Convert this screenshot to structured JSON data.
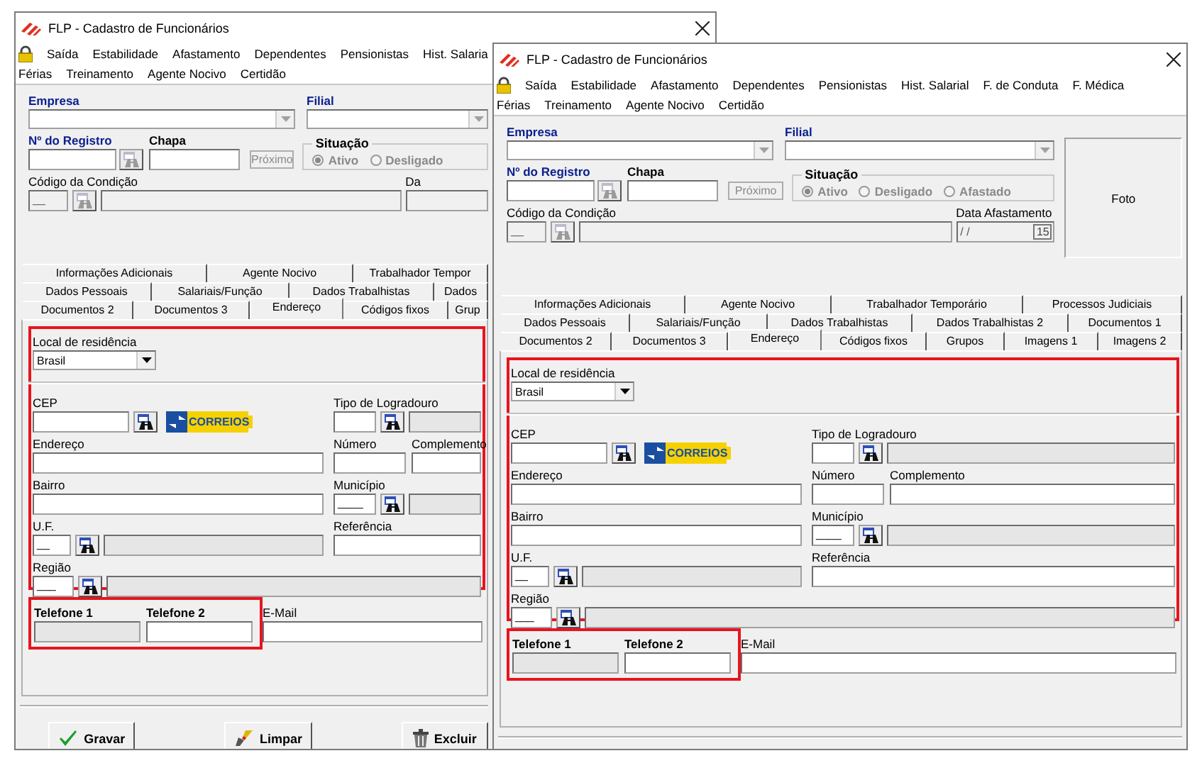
{
  "windows": [
    {
      "title": "FLP - Cadastro de Funcionários",
      "menu_rows": [
        [
          "Saída",
          "Estabilidade",
          "Afastamento",
          "Dependentes",
          "Pensionistas",
          "Hist. Salaria"
        ],
        [
          "Férias",
          "Treinamento",
          "Agente Nocivo",
          "Certidão"
        ]
      ],
      "empresa": {
        "label": "Empresa"
      },
      "filial": {
        "label": "Filial"
      },
      "registro": {
        "label": "Nº do Registro",
        "search_disabled": true
      },
      "chapa": {
        "label": "Chapa"
      },
      "next_button": {
        "label": "Próximo",
        "disabled": true
      },
      "situacao": {
        "label": "Situação",
        "disabled": true,
        "options": [
          {
            "label": "Ativo",
            "selected": true
          },
          {
            "label": "Desligado",
            "selected": false
          }
        ]
      },
      "condicao": {
        "label": "Código da Condição",
        "value": "__",
        "disabled": true
      },
      "data_afastamento": {
        "label": "Da"
      },
      "tab_rows": [
        [
          {
            "label": "Informações Adicionais",
            "selected": false
          },
          {
            "label": "Agente Nocivo",
            "selected": false
          },
          {
            "label": "Trabalhador Tempor",
            "selected": false
          }
        ],
        [
          {
            "label": "Dados Pessoais",
            "selected": false
          },
          {
            "label": "Salariais/Função",
            "selected": false
          },
          {
            "label": "Dados Trabalhistas",
            "selected": false
          },
          {
            "label": "Dados",
            "selected": false
          }
        ],
        [
          {
            "label": "Documentos 2",
            "selected": false
          },
          {
            "label": "Documentos 3",
            "selected": false
          },
          {
            "label": "Endereço",
            "selected": true
          },
          {
            "label": "Códigos fixos",
            "selected": false
          },
          {
            "label": "Grup",
            "selected": false
          }
        ]
      ],
      "address": {
        "highlighted": true,
        "country": {
          "label": "Local de residência",
          "value": "Brasil"
        },
        "cep": {
          "label": "CEP"
        },
        "logo": {
          "text": "CORREIOS"
        },
        "tipo_logradouro": {
          "label": "Tipo de Logradouro"
        },
        "endereco": {
          "label": "Endereço"
        },
        "numero": {
          "label": "Número"
        },
        "complemento": {
          "label": "Complemento"
        },
        "bairro": {
          "label": "Bairro"
        },
        "municipio": {
          "label": "Município",
          "value": "____"
        },
        "uf": {
          "label": "U.F.",
          "value": "__"
        },
        "referencia": {
          "label": "Referência"
        },
        "regiao": {
          "label": "Região",
          "value": "___"
        }
      },
      "phones": {
        "highlighted": true,
        "telefone1": {
          "label": "Telefone 1",
          "disabled": true
        },
        "telefone2": {
          "label": "Telefone 2"
        },
        "email": {
          "label": "E-Mail"
        }
      },
      "buttons": [
        {
          "label": "Gravar",
          "kind": "save"
        },
        {
          "label": "Limpar",
          "kind": "clear"
        },
        {
          "label": "Excluir",
          "kind": "delete"
        }
      ]
    },
    {
      "title": "FLP - Cadastro de Funcionários",
      "menu_rows": [
        [
          "Saída",
          "Estabilidade",
          "Afastamento",
          "Dependentes",
          "Pensionistas",
          "Hist. Salarial",
          "F. de Conduta",
          "F. Médica"
        ],
        [
          "Férias",
          "Treinamento",
          "Agente Nocivo",
          "Certidão"
        ]
      ],
      "empresa": {
        "label": "Empresa"
      },
      "filial": {
        "label": "Filial"
      },
      "registro": {
        "label": "Nº do Registro",
        "search_disabled": true
      },
      "chapa": {
        "label": "Chapa"
      },
      "next_button": {
        "label": "Próximo",
        "disabled": true
      },
      "situacao": {
        "label": "Situação",
        "disabled": true,
        "options": [
          {
            "label": "Ativo",
            "selected": true
          },
          {
            "label": "Desligado",
            "selected": false
          },
          {
            "label": "Afastado",
            "selected": false
          }
        ]
      },
      "condicao": {
        "label": "Código da Condição",
        "value": "__",
        "disabled": true
      },
      "data_afastamento": {
        "label": "Data Afastamento",
        "value": "/ /",
        "calendar": "15"
      },
      "photo": {
        "label": "Foto"
      },
      "tab_rows": [
        [
          {
            "label": "Informações Adicionais",
            "selected": false
          },
          {
            "label": "Agente Nocivo",
            "selected": false
          },
          {
            "label": "Trabalhador Temporário",
            "selected": false
          },
          {
            "label": "Processos Judiciais",
            "selected": false
          }
        ],
        [
          {
            "label": "Dados Pessoais",
            "selected": false
          },
          {
            "label": "Salariais/Função",
            "selected": false
          },
          {
            "label": "Dados Trabalhistas",
            "selected": false
          },
          {
            "label": "Dados Trabalhistas 2",
            "selected": false
          },
          {
            "label": "Documentos 1",
            "selected": false
          }
        ],
        [
          {
            "label": "Documentos 2",
            "selected": false
          },
          {
            "label": "Documentos 3",
            "selected": false
          },
          {
            "label": "Endereço",
            "selected": true
          },
          {
            "label": "Códigos fixos",
            "selected": false
          },
          {
            "label": "Grupos",
            "selected": false
          },
          {
            "label": "Imagens 1",
            "selected": false
          },
          {
            "label": "Imagens 2",
            "selected": false
          }
        ]
      ],
      "address": {
        "highlighted": true,
        "country": {
          "label": "Local de residência",
          "value": "Brasil"
        },
        "cep": {
          "label": "CEP"
        },
        "logo": {
          "text": "CORREIOS"
        },
        "tipo_logradouro": {
          "label": "Tipo de Logradouro"
        },
        "endereco": {
          "label": "Endereço"
        },
        "numero": {
          "label": "Número"
        },
        "complemento": {
          "label": "Complemento"
        },
        "bairro": {
          "label": "Bairro"
        },
        "municipio": {
          "label": "Município",
          "value": "____"
        },
        "uf": {
          "label": "U.F.",
          "value": "__"
        },
        "referencia": {
          "label": "Referência"
        },
        "regiao": {
          "label": "Região",
          "value": "___"
        }
      },
      "phones": {
        "highlighted": true,
        "telefone1": {
          "label": "Telefone 1",
          "disabled": true
        },
        "telefone2": {
          "label": "Telefone 2"
        },
        "email": {
          "label": "E-Mail"
        }
      }
    }
  ]
}
